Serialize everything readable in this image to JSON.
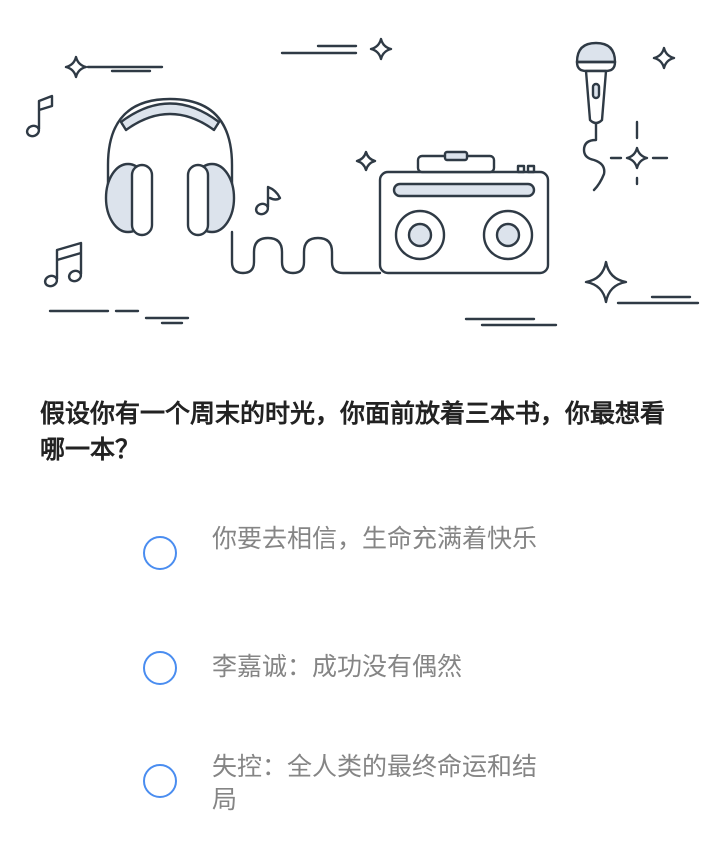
{
  "question": {
    "text": "假设你有一个周末的时光，你面前放着三本书，你最想看哪一本？"
  },
  "options": [
    {
      "label": "你要去相信，生命充满着快乐",
      "selected": false
    },
    {
      "label": "李嘉诚：成功没有偶然",
      "selected": false
    },
    {
      "label": "失控：全人类的最终命运和结局",
      "selected": false
    }
  ],
  "colors": {
    "accent": "#4a8df0",
    "line_art": "#2f3a45",
    "fill": "#dce3ec",
    "question_text": "#222222",
    "option_text": "#858585"
  },
  "illustration": {
    "icons": [
      "headphones-icon",
      "radio-icon",
      "microphone-icon",
      "music-note-icon",
      "sparkle-icon"
    ]
  }
}
